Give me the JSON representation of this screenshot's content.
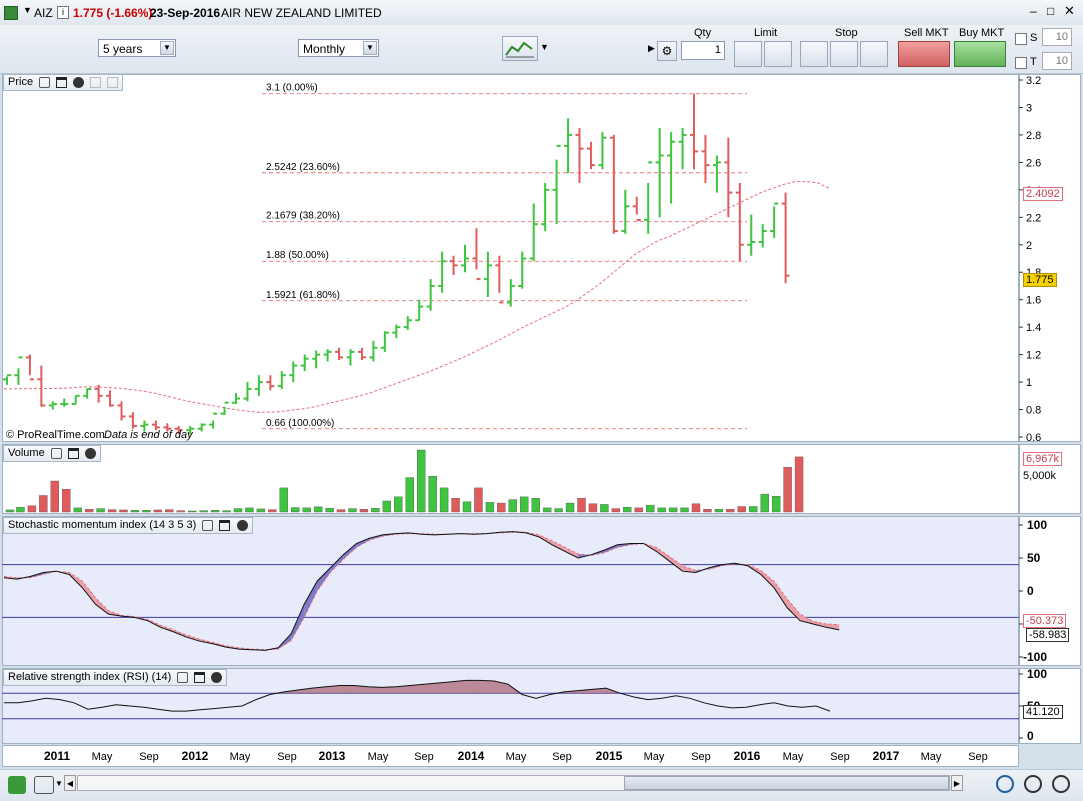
{
  "titlebar": {
    "symbol": "AIZ",
    "price_change": "1.775 (-1.66%)",
    "date": "23-Sep-2016",
    "name": "AIR NEW ZEALAND LIMITED"
  },
  "toolbar": {
    "period": "5 years",
    "interval": "Monthly",
    "qty_label": "Qty",
    "qty_value": "1",
    "limit_label": "Limit",
    "stop_label": "Stop",
    "sell_label": "Sell MKT",
    "buy_label": "Buy MKT",
    "s_label": "S",
    "s_value": "10",
    "t_label": "T",
    "t_value": "10"
  },
  "panels": {
    "price_label": "Price",
    "volume_label": "Volume",
    "smi_label": "Stochastic momentum index (14 3 5 3)",
    "rsi_label": "Relative strength index (RSI) (14)",
    "copyright": "© ProRealTime.com",
    "eod": "Data is end of day"
  },
  "badges": {
    "ma_value": "2.4092",
    "last_price": "1.775",
    "volume_ma": "6,967k",
    "smi_signal": "-50.373",
    "smi_value": "-58.983",
    "rsi_value": "41.120"
  },
  "colors": {
    "up": "#3ec43e",
    "down": "#e05c5c",
    "ma": "#e07080",
    "panel_bg": "#e8ecfa",
    "guide_line": "#3a3aa0"
  },
  "chart_data": [
    {
      "type": "bar",
      "name": "price",
      "x": [
        "2011-01",
        "2011-02",
        "2011-03",
        "2011-04",
        "2011-05",
        "2011-06",
        "2011-07",
        "2011-08",
        "2011-09",
        "2011-10",
        "2011-11",
        "2011-12",
        "2012-01",
        "2012-02",
        "2012-03",
        "2012-04",
        "2012-05",
        "2012-06",
        "2012-07",
        "2012-08",
        "2012-09",
        "2012-10",
        "2012-11",
        "2012-12",
        "2013-01",
        "2013-02",
        "2013-03",
        "2013-04",
        "2013-05",
        "2013-06",
        "2013-07",
        "2013-08",
        "2013-09",
        "2013-10",
        "2013-11",
        "2013-12",
        "2014-01",
        "2014-02",
        "2014-03",
        "2014-04",
        "2014-05",
        "2014-06",
        "2014-07",
        "2014-08",
        "2014-09",
        "2014-10",
        "2014-11",
        "2014-12",
        "2015-01",
        "2015-02",
        "2015-03",
        "2015-04",
        "2015-05",
        "2015-06",
        "2015-07",
        "2015-08",
        "2015-09",
        "2015-10",
        "2015-11",
        "2015-12",
        "2016-01",
        "2016-02",
        "2016-03",
        "2016-04",
        "2016-05",
        "2016-06",
        "2016-07",
        "2016-08",
        "2016-09"
      ],
      "open": [
        1.02,
        1.05,
        1.18,
        1.02,
        0.83,
        0.84,
        0.84,
        0.9,
        0.95,
        0.9,
        0.83,
        0.75,
        0.68,
        0.69,
        0.67,
        0.66,
        0.65,
        0.66,
        0.69,
        0.77,
        0.85,
        0.88,
        0.95,
        1.0,
        0.97,
        1.05,
        1.12,
        1.17,
        1.2,
        1.22,
        1.18,
        1.22,
        1.18,
        1.25,
        1.36,
        1.4,
        1.45,
        1.55,
        1.7,
        1.88,
        1.85,
        1.9,
        1.75,
        1.85,
        1.58,
        1.7,
        1.9,
        2.15,
        2.4,
        2.72,
        2.8,
        2.7,
        2.58,
        2.78,
        2.1,
        2.28,
        2.18,
        2.6,
        2.65,
        2.75,
        2.8,
        2.68,
        2.58,
        2.6,
        2.38,
        2.0,
        2.02,
        2.1,
        2.3
      ],
      "high": [
        1.04,
        1.1,
        1.2,
        1.12,
        0.86,
        0.88,
        0.9,
        0.95,
        0.98,
        0.94,
        0.86,
        0.78,
        0.72,
        0.72,
        0.7,
        0.68,
        0.68,
        0.7,
        0.72,
        0.82,
        0.92,
        1.0,
        1.05,
        1.05,
        1.08,
        1.15,
        1.2,
        1.23,
        1.24,
        1.25,
        1.24,
        1.25,
        1.3,
        1.37,
        1.42,
        1.48,
        1.6,
        1.75,
        1.95,
        1.92,
        2.0,
        2.12,
        1.95,
        1.92,
        1.75,
        1.95,
        2.3,
        2.45,
        2.62,
        2.92,
        2.85,
        2.75,
        2.82,
        2.8,
        2.4,
        2.35,
        2.45,
        2.85,
        2.82,
        2.85,
        3.1,
        2.8,
        2.65,
        2.78,
        2.45,
        2.22,
        2.15,
        2.28,
        2.38
      ],
      "low": [
        0.98,
        0.98,
        1.05,
        0.82,
        0.8,
        0.82,
        0.84,
        0.88,
        0.85,
        0.82,
        0.72,
        0.66,
        0.64,
        0.65,
        0.64,
        0.62,
        0.62,
        0.64,
        0.66,
        0.76,
        0.84,
        0.86,
        0.9,
        0.94,
        0.95,
        1.0,
        1.08,
        1.1,
        1.15,
        1.16,
        1.12,
        1.16,
        1.15,
        1.22,
        1.32,
        1.38,
        1.45,
        1.52,
        1.65,
        1.78,
        1.8,
        1.82,
        1.62,
        1.65,
        1.55,
        1.68,
        1.88,
        2.1,
        2.15,
        2.52,
        2.45,
        2.55,
        2.55,
        2.08,
        2.08,
        2.22,
        2.08,
        2.2,
        2.3,
        2.55,
        2.55,
        2.45,
        2.38,
        2.2,
        1.88,
        1.92,
        1.98,
        2.05,
        1.72
      ],
      "close": [
        1.05,
        1.18,
        1.02,
        0.83,
        0.84,
        0.84,
        0.9,
        0.95,
        0.9,
        0.83,
        0.75,
        0.68,
        0.69,
        0.67,
        0.66,
        0.65,
        0.66,
        0.69,
        0.77,
        0.85,
        0.88,
        0.95,
        1.0,
        0.97,
        1.05,
        1.12,
        1.17,
        1.2,
        1.22,
        1.18,
        1.22,
        1.18,
        1.25,
        1.36,
        1.4,
        1.45,
        1.55,
        1.7,
        1.88,
        1.85,
        1.9,
        1.75,
        1.85,
        1.58,
        1.7,
        1.9,
        2.15,
        2.4,
        2.72,
        2.8,
        2.7,
        2.58,
        2.78,
        2.1,
        2.28,
        2.18,
        2.6,
        2.65,
        2.75,
        2.8,
        2.68,
        2.58,
        2.6,
        2.38,
        2.0,
        2.02,
        2.1,
        2.3,
        1.775
      ],
      "moving_average": [
        0.95,
        0.955,
        0.96,
        0.965,
        0.965,
        0.96,
        0.955,
        0.945,
        0.935,
        0.92,
        0.9,
        0.88,
        0.86,
        0.845,
        0.83,
        0.815,
        0.8,
        0.79,
        0.78,
        0.78,
        0.785,
        0.795,
        0.805,
        0.82,
        0.84,
        0.86,
        0.88,
        0.9,
        0.925,
        0.955,
        0.985,
        1.015,
        1.045,
        1.075,
        1.11,
        1.145,
        1.18,
        1.22,
        1.26,
        1.3,
        1.345,
        1.39,
        1.43,
        1.47,
        1.51,
        1.55,
        1.6,
        1.66,
        1.72,
        1.79,
        1.86,
        1.93,
        1.98,
        2.03,
        2.06,
        2.1,
        2.14,
        2.18,
        2.22,
        2.26,
        2.3,
        2.34,
        2.38,
        2.41,
        2.44,
        2.46,
        2.46,
        2.45,
        2.41
      ],
      "fibonacci": [
        {
          "label": "3.1 (0.00%)",
          "value": 3.1
        },
        {
          "label": "2.5242 (23.60%)",
          "value": 2.5242
        },
        {
          "label": "2.1679 (38.20%)",
          "value": 2.1679
        },
        {
          "label": "1.88 (50.00%)",
          "value": 1.88
        },
        {
          "label": "1.5921 (61.80%)",
          "value": 1.5921
        },
        {
          "label": "0.66 (100.00%)",
          "value": 0.66
        }
      ],
      "y_ticks": [
        "3.2",
        "3",
        "2.8",
        "2.6",
        "2.4",
        "2.2",
        "2",
        "1.8",
        "1.6",
        "1.4",
        "1.2",
        "1",
        "0.8",
        "0.6"
      ],
      "ylim": [
        0.6,
        3.2
      ]
    },
    {
      "type": "bar",
      "name": "volume",
      "values": [
        300,
        700,
        900,
        2400,
        4500,
        3300,
        600,
        400,
        500,
        350,
        300,
        250,
        250,
        300,
        350,
        200,
        150,
        200,
        250,
        200,
        500,
        600,
        450,
        350,
        3500,
        650,
        600,
        750,
        550,
        350,
        500,
        400,
        550,
        1600,
        2200,
        5000,
        9000,
        5200,
        3500,
        2000,
        1500,
        3500,
        1400,
        1300,
        1800,
        2200,
        2000,
        600,
        500,
        1300,
        2000,
        1200,
        1100,
        500,
        700,
        600,
        1000,
        600,
        600,
        600,
        1200,
        400,
        400,
        400,
        800,
        800,
        2600,
        2300,
        6500,
        8000
      ],
      "up": [
        true,
        true,
        false,
        false,
        false,
        false,
        true,
        false,
        true,
        false,
        false,
        true,
        true,
        false,
        false,
        false,
        true,
        true,
        true,
        true,
        true,
        true,
        true,
        false,
        true,
        true,
        true,
        true,
        true,
        false,
        true,
        false,
        true,
        true,
        true,
        true,
        true,
        true,
        true,
        false,
        true,
        false,
        true,
        false,
        true,
        true,
        true,
        true,
        true,
        true,
        false,
        false,
        true,
        false,
        true,
        false,
        true,
        true,
        true,
        true,
        false,
        false,
        true,
        false,
        false,
        true,
        true,
        true,
        false
      ],
      "y_ticks": [
        "5,000k"
      ]
    },
    {
      "type": "line",
      "name": "stochastic momentum index",
      "smi": [
        20,
        18,
        22,
        28,
        30,
        25,
        5,
        -20,
        -35,
        -38,
        -40,
        -45,
        -55,
        -62,
        -70,
        -76,
        -80,
        -85,
        -88,
        -89,
        -90,
        -86,
        -65,
        -20,
        15,
        35,
        55,
        72,
        80,
        85,
        87,
        88,
        86,
        85,
        86,
        87,
        86,
        87,
        89,
        90,
        88,
        82,
        70,
        60,
        50,
        55,
        62,
        70,
        72,
        72,
        60,
        45,
        30,
        28,
        35,
        40,
        42,
        38,
        25,
        5,
        -25,
        -45,
        -50,
        -55,
        -59
      ],
      "signal": [
        22,
        20,
        20,
        25,
        30,
        28,
        15,
        -10,
        -30,
        -37,
        -39,
        -43,
        -52,
        -59,
        -67,
        -73,
        -78,
        -83,
        -86,
        -88,
        -89,
        -88,
        -75,
        -40,
        0,
        28,
        48,
        66,
        77,
        83,
        86,
        87,
        87,
        86,
        86,
        87,
        87,
        87,
        88,
        89,
        89,
        85,
        76,
        66,
        56,
        54,
        58,
        66,
        70,
        72,
        66,
        52,
        38,
        31,
        33,
        38,
        41,
        40,
        31,
        15,
        -12,
        -35,
        -46,
        -50,
        -51
      ],
      "y_ticks": [
        "100",
        "50",
        "0",
        "-50",
        "-100"
      ],
      "ylim": [
        -100,
        100
      ]
    },
    {
      "type": "line",
      "name": "relative strength index",
      "values": [
        55,
        55,
        58,
        62,
        60,
        55,
        45,
        48,
        52,
        50,
        48,
        45,
        42,
        42,
        44,
        46,
        48,
        50,
        60,
        68,
        72,
        75,
        78,
        80,
        82,
        82,
        80,
        79,
        80,
        82,
        84,
        86,
        88,
        90,
        90,
        89,
        84,
        68,
        62,
        68,
        72,
        74,
        76,
        78,
        70,
        64,
        60,
        62,
        66,
        62,
        55,
        50,
        47,
        48,
        52,
        55,
        50,
        48,
        50,
        42
      ],
      "y_ticks": [
        "100",
        "50",
        "0"
      ],
      "ylim": [
        0,
        100
      ]
    }
  ],
  "time_axis": [
    "2011",
    "May",
    "Sep",
    "2012",
    "May",
    "Sep",
    "2013",
    "May",
    "Sep",
    "2014",
    "May",
    "Sep",
    "2015",
    "May",
    "Sep",
    "2016",
    "May",
    "Sep",
    "2017",
    "May",
    "Sep"
  ]
}
